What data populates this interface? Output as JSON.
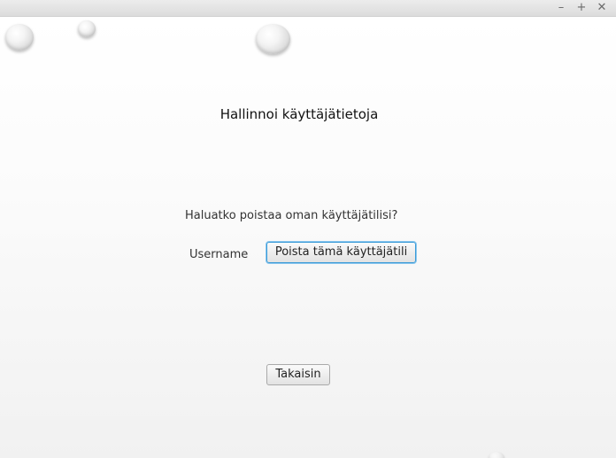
{
  "window": {
    "minimize_glyph": "–",
    "maximize_glyph": "+",
    "close_glyph": "✕"
  },
  "main": {
    "title": "Hallinnoi käyttäjätietoja",
    "question": "Haluatko poistaa oman käyttäjätilisi?",
    "username_label": "Username",
    "delete_button": "Poista tämä käyttäjätili",
    "back_button": "Takaisin"
  },
  "colors": {
    "focus_accent": "#3a9bd8",
    "titlebar": "#e4e4e4"
  }
}
